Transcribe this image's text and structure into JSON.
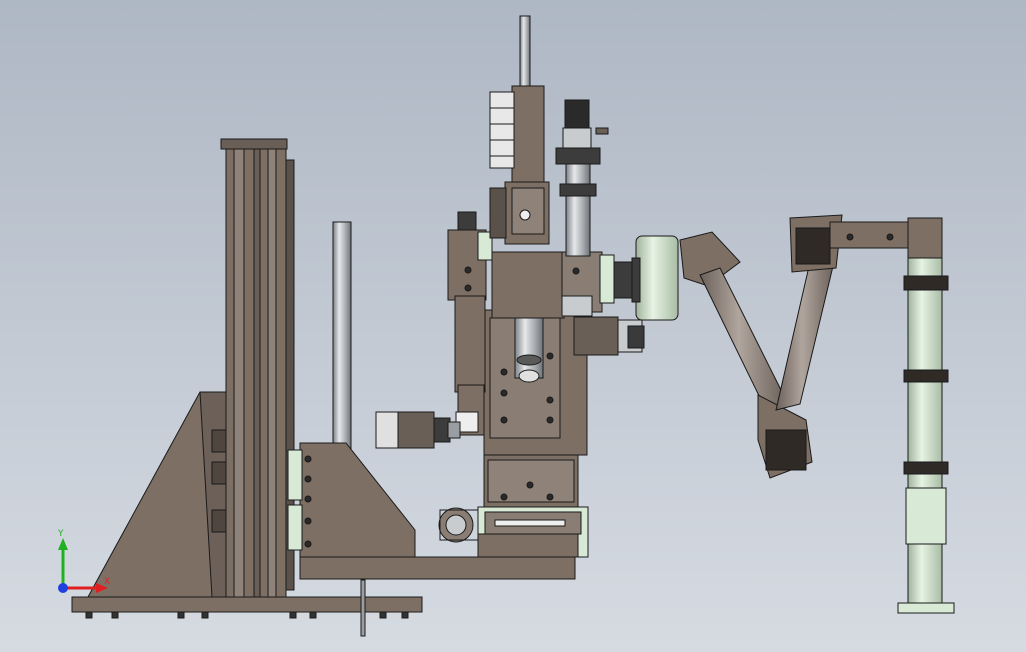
{
  "viewport": {
    "background_top": "#aeb7c4",
    "background_bottom": "#d6dbe2"
  },
  "colors": {
    "body": "#7d6f64",
    "body_dark": "#5f544c",
    "body_light": "#968a80",
    "edge": "#1a1a1a",
    "chrome": "#c9cccf",
    "chrome_dark": "#8d9195",
    "pale_green": "#d8ead5",
    "arm": "#8a8078",
    "axis_x": "#e02020",
    "axis_y": "#20b020",
    "axis_z": "#2040e0"
  },
  "triad": {
    "x_label": "X",
    "y_label": "Y"
  }
}
